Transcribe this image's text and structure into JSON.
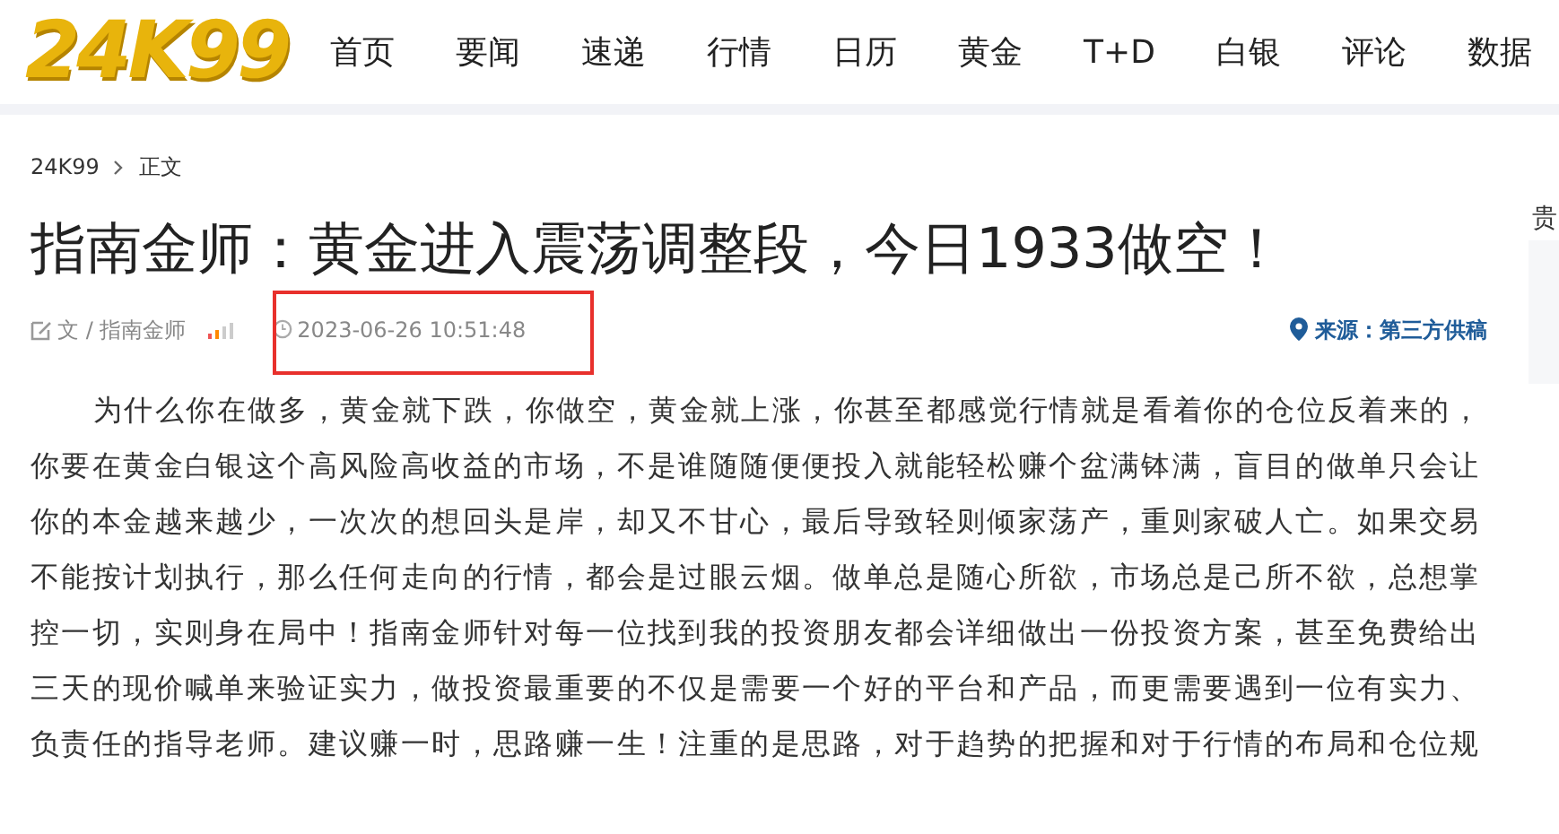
{
  "header": {
    "logo": "24K99",
    "nav": [
      {
        "label": "首页"
      },
      {
        "label": "要闻"
      },
      {
        "label": "速递"
      },
      {
        "label": "行情"
      },
      {
        "label": "日历"
      },
      {
        "label": "黄金"
      },
      {
        "label": "T+D"
      },
      {
        "label": "白银"
      },
      {
        "label": "评论"
      },
      {
        "label": "数据"
      }
    ]
  },
  "breadcrumb": [
    "24K99",
    "正文"
  ],
  "article": {
    "title": "指南金师：黄金进入震荡调整段，今日1933做空！",
    "author": "文 / 指南金师",
    "date": "2023-06-26 10:51:48",
    "date_highlighted": true,
    "source": "来源：第三方供稿",
    "body_lines": [
      "为什么你在做多，黄金就下跌，你做空，黄金就上涨，你甚至都感觉行情就是看着你的仓位反着来的，",
      "你要在黄金白银这个高风险高收益的市场，不是谁随随便便投入就能轻松赚个盆满钵满，盲目的做单只会让",
      "你的本金越来越少，一次次的想回头是岸，却又不甘心，最后导致轻则倾家荡产，重则家破人亡。如果交易",
      "不能按计划执行，那么任何走向的行情，都会是过眼云烟。做单总是随心所欲，市场总是己所不欲，总想掌",
      "控一切，实则身在局中！指南金师针对每一位找到我的投资朋友都会详细做出一份投资方案，甚至免费给出",
      "三天的现价喊单来验证实力，做投资最重要的不仅是需要一个好的平台和产品，而更需要遇到一位有实力、",
      "负责任的指导老师。建议赚一时，思路赚一生！注重的是思路，对于趋势的把握和对于行情的布局和仓位规"
    ]
  },
  "sidebar": {
    "heading": "贵"
  }
}
